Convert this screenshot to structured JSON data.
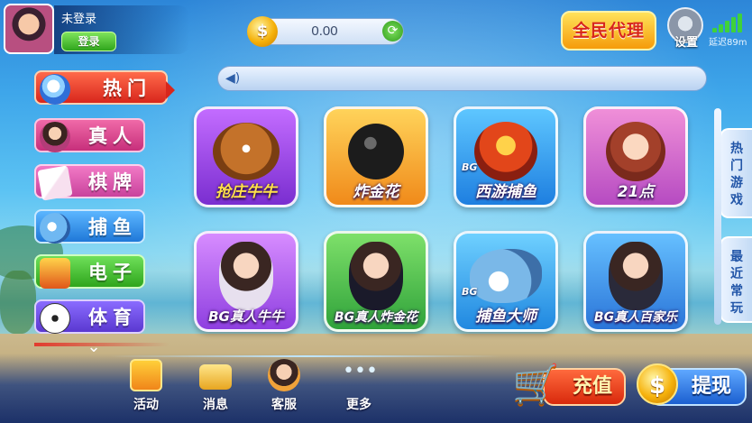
{
  "user": {
    "name": "未登录",
    "login_label": "登录",
    "avatar_icon": "avatar-girl-icon"
  },
  "wallet": {
    "balance": "0.00",
    "coin_icon": "coin-plus-icon",
    "refresh_icon": "refresh-icon"
  },
  "header": {
    "agent_label": "全民代理",
    "settings_label": "设置",
    "latency_label": "延迟89m",
    "signal_bars": 5
  },
  "notice": {
    "speaker_icon": "speaker-icon",
    "text": ""
  },
  "sidebar": {
    "items": [
      {
        "label": "热门",
        "icon": "rocket-icon",
        "active": true
      },
      {
        "label": "真人",
        "icon": "dealer-girl-icon",
        "active": false
      },
      {
        "label": "棋牌",
        "icon": "cards-icon",
        "active": false
      },
      {
        "label": "捕鱼",
        "icon": "fish-icon",
        "active": false
      },
      {
        "label": "电子",
        "icon": "slot-machine-icon",
        "active": false
      },
      {
        "label": "体育",
        "icon": "soccer-ball-icon",
        "active": false
      }
    ],
    "more_icon": "chevron-down-icon"
  },
  "games": [
    {
      "label": "抢庄牛牛",
      "icon": "bull-icon",
      "tag": ""
    },
    {
      "label": "炸金花",
      "icon": "bomb-icon",
      "tag": ""
    },
    {
      "label": "西游捕鱼",
      "icon": "monkey-king-icon",
      "tag": "BG"
    },
    {
      "label": "21点",
      "icon": "blackjack-girl-icon",
      "tag": ""
    },
    {
      "label": "BG真人牛牛",
      "icon": "dealer-girl-icon",
      "tag": ""
    },
    {
      "label": "BG真人炸金花",
      "icon": "dealer-girl-icon",
      "tag": ""
    },
    {
      "label": "捕鱼大师",
      "icon": "shark-icon",
      "tag": "BG"
    },
    {
      "label": "BG真人百家乐",
      "icon": "dealer-girl-icon",
      "tag": ""
    }
  ],
  "right_tabs": [
    {
      "label": "热门游戏"
    },
    {
      "label": "最近常玩"
    }
  ],
  "bottom_nav": [
    {
      "label": "活动",
      "icon": "gift-box-icon"
    },
    {
      "label": "消息",
      "icon": "envelope-icon"
    },
    {
      "label": "客服",
      "icon": "headset-agent-icon"
    },
    {
      "label": "更多",
      "icon": "more-dots-icon"
    }
  ],
  "actions": {
    "deposit_label": "充值",
    "deposit_icon": "shopping-cart-icon",
    "withdraw_label": "提现",
    "withdraw_icon": "dollar-coin-icon"
  },
  "colors": {
    "sidebar_hot": "#e23b2e",
    "sidebar_live": "#d8438f",
    "sidebar_cards": "#e85ab0",
    "sidebar_fish": "#2f8fe0",
    "sidebar_slots": "#3fb83a",
    "sidebar_sports": "#6b4fd8",
    "tile_purple": "#9a3fd8",
    "tile_orange": "#f2a12a",
    "tile_blue": "#3aa6ef",
    "tile_pink": "#d560c8",
    "tile_green": "#4cc24a"
  }
}
